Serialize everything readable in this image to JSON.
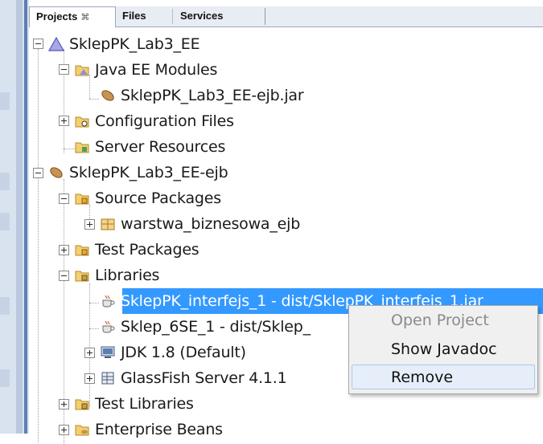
{
  "tabs": [
    {
      "label": "Projects",
      "close": "⌘",
      "active": true
    },
    {
      "label": "Files",
      "active": false
    },
    {
      "label": "Services",
      "active": false
    }
  ],
  "tree": [
    {
      "label": "SklepPK_Lab3_EE",
      "icon": "enterprise-project-icon"
    },
    {
      "label": "Java EE Modules",
      "icon": "modules-folder-icon"
    },
    {
      "label": "SklepPK_Lab3_EE-ejb.jar",
      "icon": "ejb-jar-icon"
    },
    {
      "label": "Configuration Files",
      "icon": "config-folder-icon"
    },
    {
      "label": "Server Resources",
      "icon": "server-resources-folder-icon"
    },
    {
      "label": "SklepPK_Lab3_EE-ejb",
      "icon": "ejb-project-icon"
    },
    {
      "label": "Source Packages",
      "icon": "source-packages-folder-icon"
    },
    {
      "label": "warstwa_biznesowa_ejb",
      "icon": "package-icon"
    },
    {
      "label": "Test Packages",
      "icon": "test-packages-folder-icon"
    },
    {
      "label": "Libraries",
      "icon": "libraries-folder-icon"
    },
    {
      "label": "SklepPK_interfejs_1 - dist/SklepPK_interfejs_1.jar",
      "icon": "library-jar-icon"
    },
    {
      "label": "Sklep_6SE_1 - dist/Sklep_",
      "icon": "library-jar-icon"
    },
    {
      "label": "JDK 1.8 (Default)",
      "icon": "jdk-icon"
    },
    {
      "label": "GlassFish Server 4.1.1",
      "icon": "server-icon"
    },
    {
      "label": "Test Libraries",
      "icon": "test-libraries-folder-icon"
    },
    {
      "label": "Enterprise Beans",
      "icon": "enterprise-beans-folder-icon"
    }
  ],
  "context_menu": [
    {
      "label": "Open Project",
      "enabled": false
    },
    {
      "label": "Show Javadoc",
      "enabled": true
    },
    {
      "label": "Remove",
      "enabled": true,
      "highlighted": true
    }
  ],
  "colors": {
    "selection": "#3399ff",
    "folder": "#e6b64a",
    "bean": "#b5824a"
  }
}
